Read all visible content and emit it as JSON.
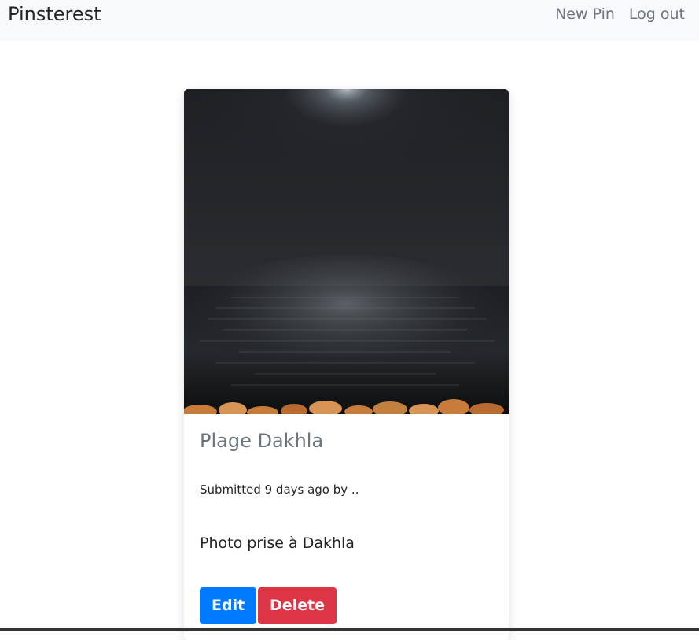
{
  "navbar": {
    "brand": "Pinsterest",
    "links": [
      {
        "label": "New Pin"
      },
      {
        "label": "Log out"
      }
    ],
    "background": "#f8f9fa"
  },
  "pin": {
    "title": "Plage Dakhla",
    "meta": "Submitted 9 days ago by ..",
    "description": "Photo prise à Dakhla",
    "image_subject": "night-sea-with-moonlight-and-rocks"
  },
  "actions": {
    "edit_label": "Edit",
    "delete_label": "Delete",
    "edit_color": "#007bff",
    "delete_color": "#dc3545"
  }
}
